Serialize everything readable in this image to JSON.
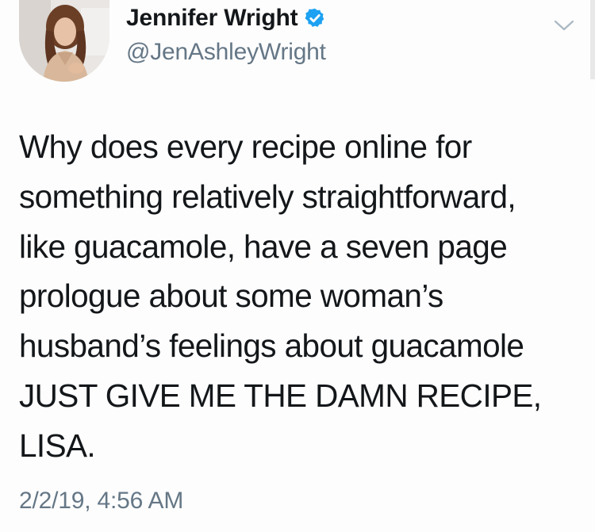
{
  "author": {
    "display_name": "Jennifer Wright",
    "handle": "@JenAshleyWright",
    "verified": true,
    "verified_icon": "verified-badge-icon",
    "verified_color": "#1da1f2"
  },
  "tweet": {
    "lines": [
      "Why does every recipe online for",
      "something relatively straightforward,",
      "like guacamole, have a seven page",
      "prologue about some woman’s",
      "husband’s feelings about guacamole",
      "JUST GIVE ME THE DAMN RECIPE,",
      "LISA."
    ],
    "timestamp": "2/2/19, 4:56 AM"
  },
  "menu": {
    "icon": "chevron-down-icon"
  },
  "colors": {
    "text": "#14171a",
    "secondary": "#657786",
    "verified": "#1da1f2",
    "background": "#fdfdfd"
  }
}
